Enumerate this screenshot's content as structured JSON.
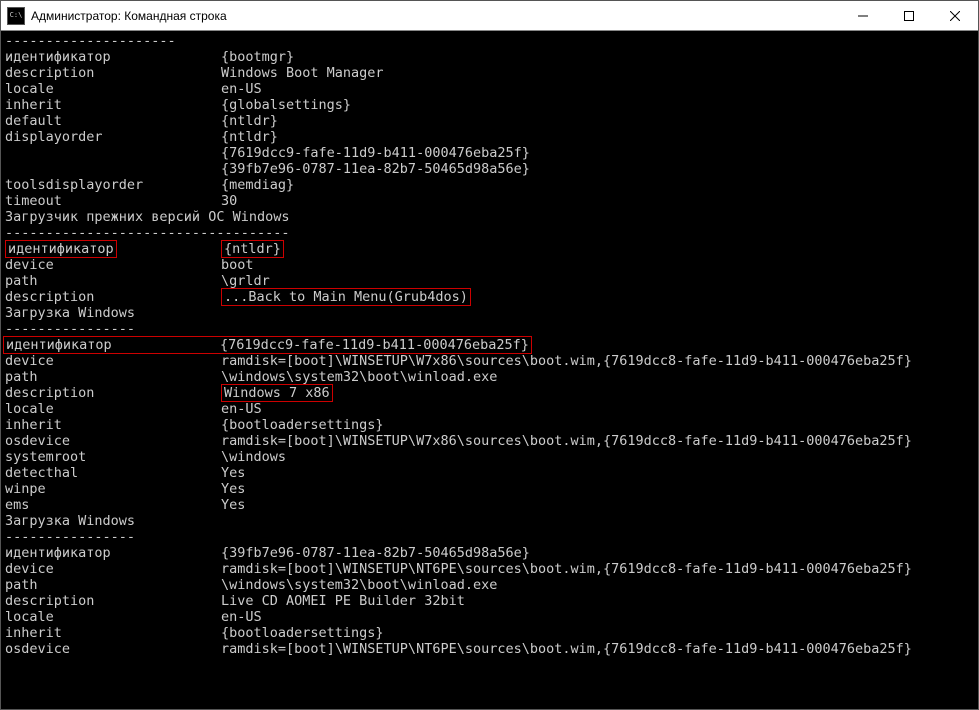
{
  "window": {
    "title": "Администратор: Командная строка",
    "icon_label": "C:\\"
  },
  "divider": "--------------------------",
  "sections": {
    "bootmgr": {
      "separator_top": "---------------------",
      "rows": [
        {
          "key": "идентификатор",
          "val": "{bootmgr}"
        },
        {
          "key": "description",
          "val": "Windows Boot Manager"
        },
        {
          "key": "locale",
          "val": "en-US"
        },
        {
          "key": "inherit",
          "val": "{globalsettings}"
        },
        {
          "key": "default",
          "val": "{ntldr}"
        },
        {
          "key": "displayorder",
          "val": "{ntldr}"
        },
        {
          "key": "",
          "val": "{7619dcc9-fafe-11d9-b411-000476eba25f}"
        },
        {
          "key": "",
          "val": "{39fb7e96-0787-11ea-82b7-50465d98a56e}"
        },
        {
          "key": "toolsdisplayorder",
          "val": "{memdiag}"
        },
        {
          "key": "timeout",
          "val": "30"
        }
      ]
    },
    "legacy": {
      "heading": "Загрузчик прежних версий ОС Windows",
      "separator": "-----------------------------------",
      "rows": [
        {
          "key": "идентификатор",
          "val": "{ntldr}",
          "highlight_key": true,
          "highlight_val": true
        },
        {
          "key": "device",
          "val": "boot"
        },
        {
          "key": "path",
          "val": "\\grldr"
        },
        {
          "key": "description",
          "val": "...Back to Main Menu(Grub4dos)",
          "highlight_val": true
        }
      ]
    },
    "winload1": {
      "heading": "Загрузка Windows",
      "separator": "----------------",
      "rows": [
        {
          "key": "идентификатор",
          "val": "{7619dcc9-fafe-11d9-b411-000476eba25f}",
          "highlight_key": true,
          "highlight_val": true,
          "joined": true
        },
        {
          "key": "device",
          "val": "ramdisk=[boot]\\WINSETUP\\W7x86\\sources\\boot.wim,{7619dcc8-fafe-11d9-b411-000476eba25f}"
        },
        {
          "key": "path",
          "val": "\\windows\\system32\\boot\\winload.exe"
        },
        {
          "key": "description",
          "val": "Windows 7 x86",
          "highlight_val": true
        },
        {
          "key": "locale",
          "val": "en-US"
        },
        {
          "key": "inherit",
          "val": "{bootloadersettings}"
        },
        {
          "key": "osdevice",
          "val": "ramdisk=[boot]\\WINSETUP\\W7x86\\sources\\boot.wim,{7619dcc8-fafe-11d9-b411-000476eba25f}"
        },
        {
          "key": "systemroot",
          "val": "\\windows"
        },
        {
          "key": "detecthal",
          "val": "Yes"
        },
        {
          "key": "winpe",
          "val": "Yes"
        },
        {
          "key": "ems",
          "val": "Yes"
        }
      ]
    },
    "winload2": {
      "heading": "Загрузка Windows",
      "separator": "----------------",
      "rows": [
        {
          "key": "идентификатор",
          "val": "{39fb7e96-0787-11ea-82b7-50465d98a56e}"
        },
        {
          "key": "device",
          "val": "ramdisk=[boot]\\WINSETUP\\NT6PE\\sources\\boot.wim,{7619dcc8-fafe-11d9-b411-000476eba25f}"
        },
        {
          "key": "path",
          "val": "\\windows\\system32\\boot\\winload.exe"
        },
        {
          "key": "description",
          "val": "Live CD AOMEI PE Builder 32bit"
        },
        {
          "key": "locale",
          "val": "en-US"
        },
        {
          "key": "inherit",
          "val": "{bootloadersettings}"
        },
        {
          "key": "osdevice",
          "val": "ramdisk=[boot]\\WINSETUP\\NT6PE\\sources\\boot.wim,{7619dcc8-fafe-11d9-b411-000476eba25f}"
        }
      ]
    }
  }
}
